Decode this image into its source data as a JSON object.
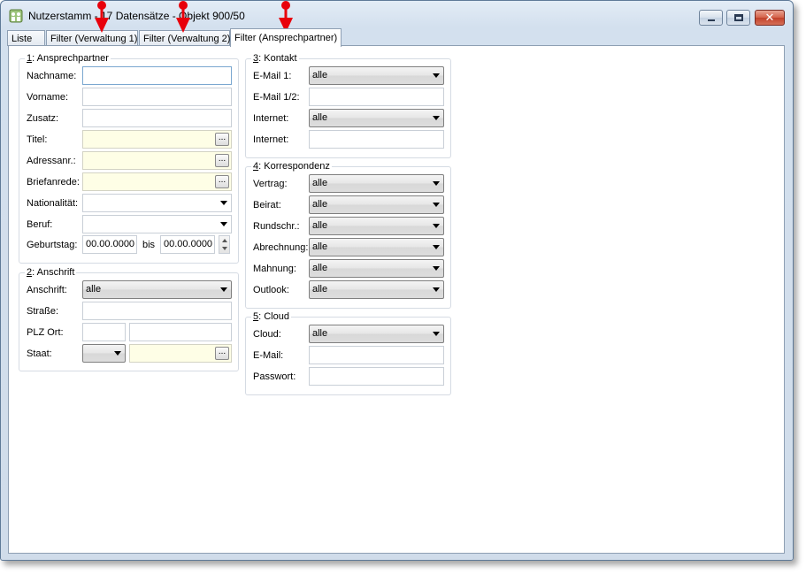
{
  "window": {
    "title": "Nutzerstamm - 17 Datensätze - Objekt 900/50",
    "close_glyph": "✕"
  },
  "tabs": [
    {
      "label": "Liste"
    },
    {
      "label": "Filter (Verwaltung 1)"
    },
    {
      "label": "Filter (Verwaltung 2)"
    },
    {
      "label": "Filter (Ansprechpartner)"
    }
  ],
  "ansprechpartner": {
    "legend_num": "1",
    "legend_text": ": Ansprechpartner",
    "nachname_label": "Nachname:",
    "vorname_label": "Vorname:",
    "zusatz_label": "Zusatz:",
    "titel_label": "Titel:",
    "adressanr_label": "Adressanr.:",
    "briefanrede_label": "Briefanrede:",
    "nationalitaet_label": "Nationalität:",
    "beruf_label": "Beruf:",
    "geburtstag_label": "Geburtstag:",
    "geburtstag_from": "00.00.0000",
    "bis_label": "bis",
    "geburtstag_to": "00.00.0000",
    "dots": "..."
  },
  "anschrift": {
    "legend_num": "2",
    "legend_text": ": Anschrift",
    "anschrift_label": "Anschrift:",
    "anschrift_value": "alle",
    "strasse_label": "Straße:",
    "plzort_label": "PLZ Ort:",
    "staat_label": "Staat:",
    "dots": "..."
  },
  "kontakt": {
    "legend_num": "3",
    "legend_text": ": Kontakt",
    "email1_label": "E-Mail 1:",
    "email1_value": "alle",
    "email12_label": "E-Mail 1/2:",
    "internet1_label": "Internet:",
    "internet1_value": "alle",
    "internet2_label": "Internet:"
  },
  "korrespondenz": {
    "legend_num": "4",
    "legend_text": ": Korrespondenz",
    "rows": [
      {
        "label": "Vertrag:",
        "value": "alle"
      },
      {
        "label": "Beirat:",
        "value": "alle"
      },
      {
        "label": "Rundschr.:",
        "value": "alle"
      },
      {
        "label": "Abrechnung:",
        "value": "alle"
      },
      {
        "label": "Mahnung:",
        "value": "alle"
      },
      {
        "label": "Outlook:",
        "value": "alle"
      }
    ]
  },
  "cloud": {
    "legend_num": "5",
    "legend_text": ": Cloud",
    "cloud_label": "Cloud:",
    "cloud_value": "alle",
    "email_label": "E-Mail:",
    "passwort_label": "Passwort:"
  },
  "colors": {
    "pointer": "#e8000b",
    "input_yellow": "#fefee6"
  }
}
